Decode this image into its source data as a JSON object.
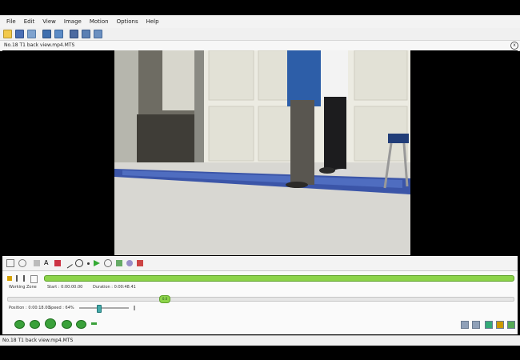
{
  "menu": [
    "File",
    "Edit",
    "View",
    "Image",
    "Motion",
    "Options",
    "Help"
  ],
  "file_tab": {
    "name": "No.18 T1 back view.mp4.MTS",
    "close": "x"
  },
  "working_zone": {
    "label": "Working Zone",
    "start": "Start : 0:00:00.00",
    "duration": "Duration : 0:00:48.41",
    "marker": "0.0"
  },
  "position": {
    "label": "Position : 0:00:18.00",
    "speed": "Speed : 64%",
    "speed_level": 0.45
  },
  "status_bar": {
    "text": "No.18 T1 back view.mp4.MTS"
  },
  "colors": {
    "accent_green": "#8dd44a",
    "play_green": "#3aa13a"
  },
  "icons": [
    "open-icon",
    "save-icon",
    "export-icon",
    "settings-icon",
    "close-icon"
  ]
}
